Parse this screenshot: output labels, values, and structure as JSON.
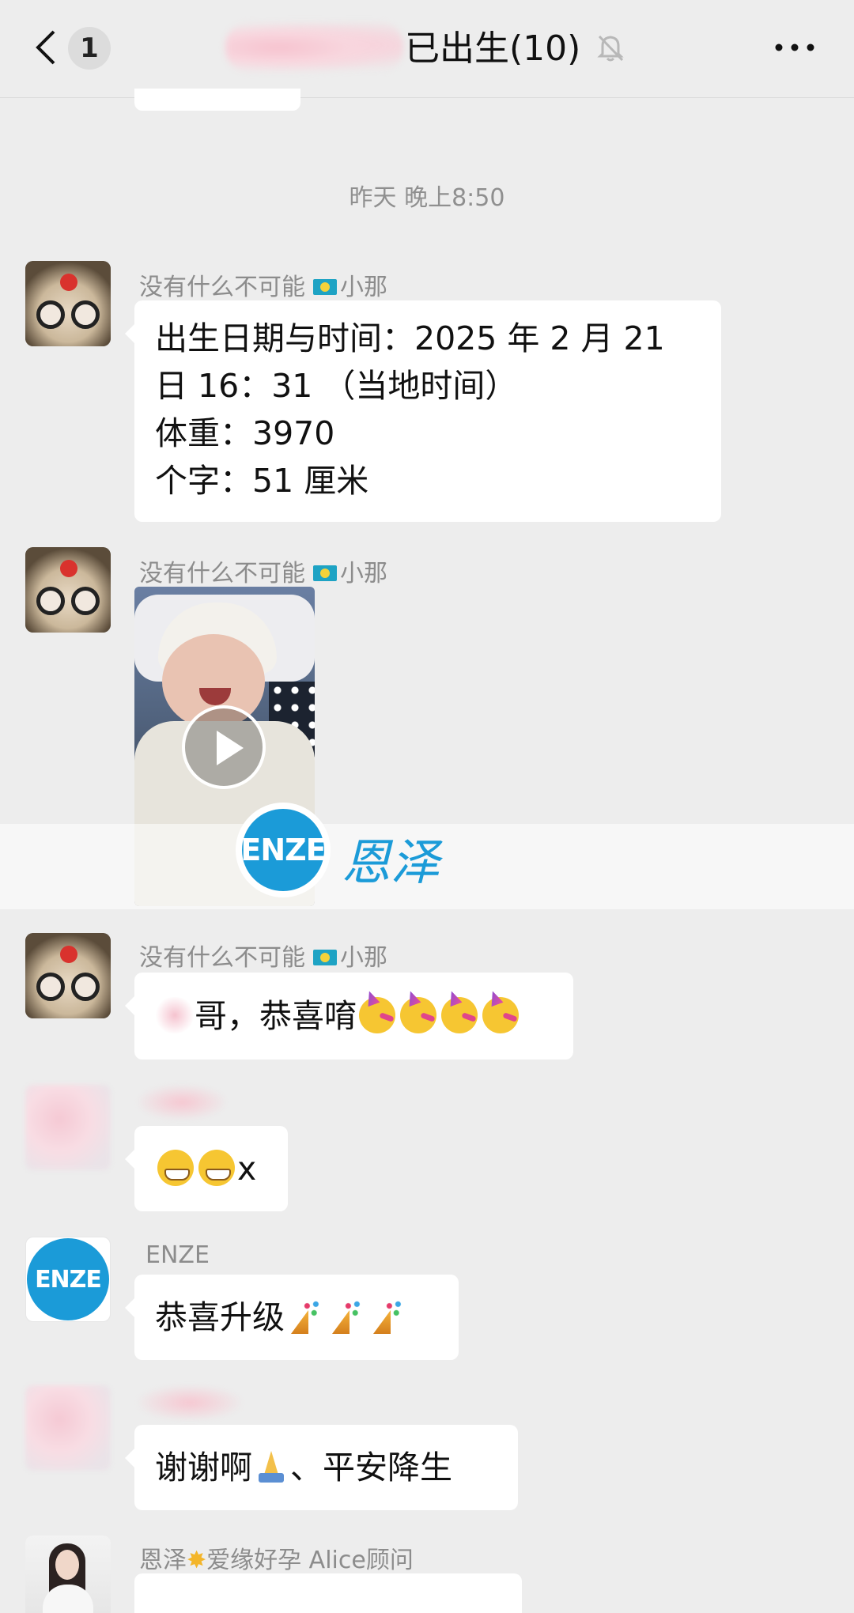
{
  "header": {
    "unread_count": "1",
    "title": "已出生(10)"
  },
  "timestamp": "昨天 晚上8:50",
  "messages": [
    {
      "sender": "没有什么不可能",
      "sender_suffix": "小那",
      "lines": [
        "出生日期与时间：2025 年 2 月 21",
        "日 16：31 （当地时间）",
        "体重：3970",
        "个字：51 厘米"
      ]
    },
    {
      "sender": "没有什么不可能",
      "sender_suffix": "小那",
      "type": "video"
    },
    {
      "sender": "没有什么不可能",
      "sender_suffix": "小那",
      "text": "哥，恭喜唷"
    },
    {
      "text_suffix": "x"
    },
    {
      "sender": "ENZE",
      "text": "恭喜升级"
    },
    {
      "text_a": "谢谢啊",
      "text_b": "、平安降生"
    },
    {
      "sender": "恩泽",
      "sender_suffix": "爱缘好孕 Alice顾问"
    }
  ],
  "watermark": {
    "logo": "ENZE",
    "text": "恩泽"
  },
  "avatar_enze_label": "ENZE",
  "colors": {
    "background": "#ededed",
    "bubble": "#ffffff",
    "brand_blue": "#1b9bd8"
  },
  "icons": [
    "back-arrow-icon",
    "mute-bell-icon",
    "more-icon",
    "play-icon",
    "kazakhstan-flag-icon",
    "partying-face-emoji",
    "grinning-emoji",
    "party-popper-emoji",
    "folded-hands-emoji",
    "star-emoji"
  ]
}
